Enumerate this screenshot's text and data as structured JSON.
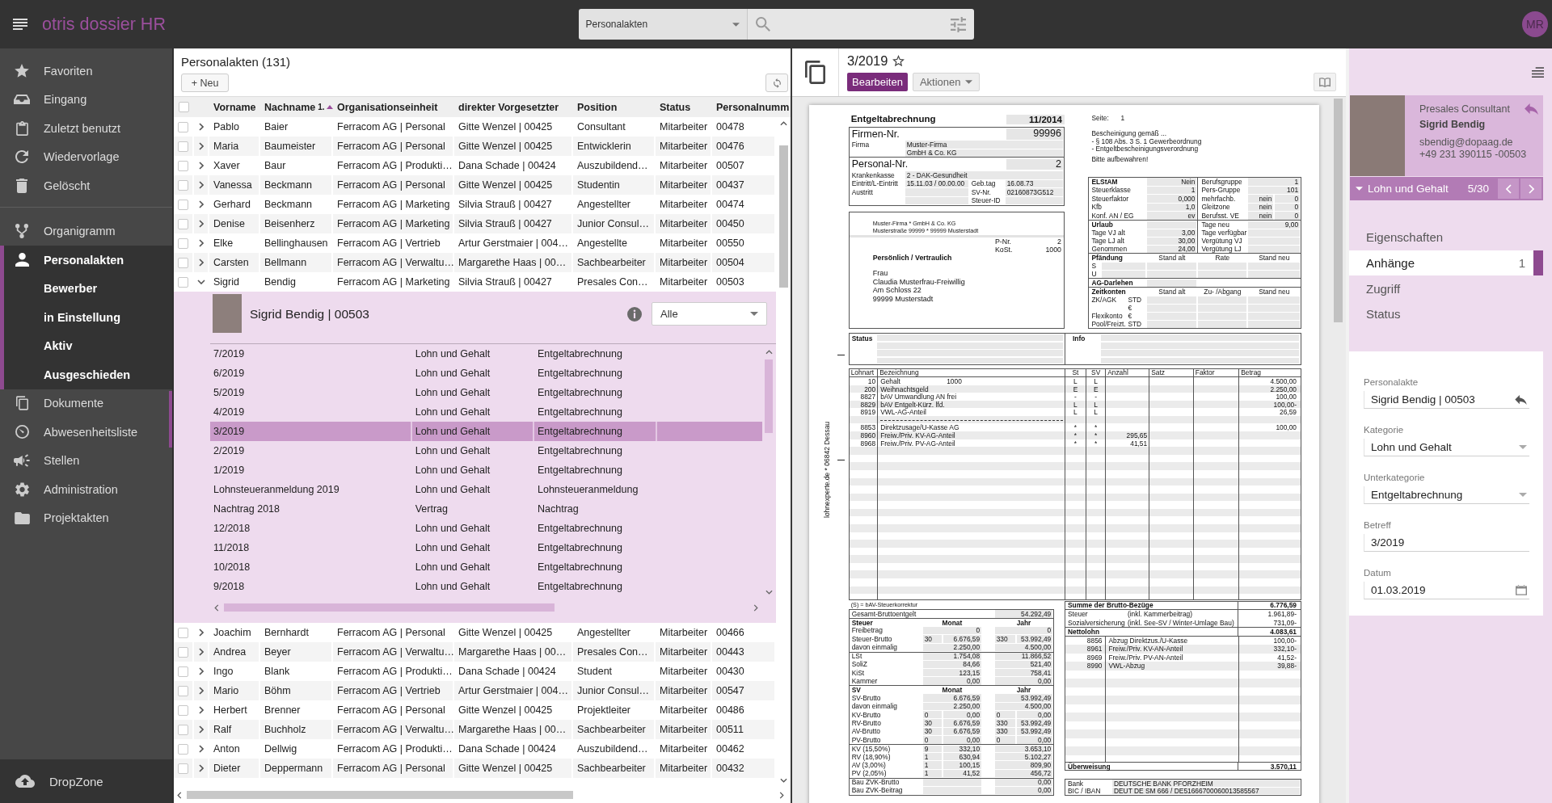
{
  "app": {
    "title": "otris dossier HR",
    "avatar": "MR"
  },
  "search": {
    "scope": "Personalakten"
  },
  "sidebar": {
    "groups": [
      {
        "items": [
          {
            "label": "Favoriten",
            "selected": false
          },
          {
            "label": "Eingang",
            "selected": false
          },
          {
            "label": "Zuletzt benutzt",
            "selected": false
          },
          {
            "label": "Wiedervorlage",
            "selected": false
          },
          {
            "label": "Gelöscht",
            "selected": false
          }
        ]
      },
      {
        "items": [
          {
            "label": "Organigramm",
            "selected": false
          },
          {
            "label": "Personalakten",
            "selected": true,
            "expanded": true,
            "children": [
              {
                "label": "Bewerber",
                "selected": false
              },
              {
                "label": "in Einstellung",
                "selected": false
              },
              {
                "label": "Aktiv",
                "selected": false
              },
              {
                "label": "Ausgeschieden",
                "selected": false
              }
            ]
          },
          {
            "label": "Dokumente",
            "selected": false
          },
          {
            "label": "Abwesenheitsliste",
            "selected": false
          },
          {
            "label": "Stellen",
            "selected": false
          },
          {
            "label": "Administration",
            "selected": false
          },
          {
            "label": "Projektakten",
            "selected": false
          }
        ]
      }
    ],
    "footer": "DropZone"
  },
  "list": {
    "title": "Personalakten (131)",
    "new_button": "+ Neu",
    "all_checked": false,
    "columns": [
      {
        "label": "Vorname"
      },
      {
        "label": "Nachname",
        "sort_ascending": true,
        "sort_rank": "1."
      },
      {
        "label": "Organisationseinheit"
      },
      {
        "label": "direkter Vorgesetzter"
      },
      {
        "label": "Position"
      },
      {
        "label": "Status"
      },
      {
        "label": "Personalnumm"
      }
    ],
    "rows": [
      {
        "cells": [
          "Pablo",
          "Baier",
          "Ferracom AG | Personal",
          "Gitte Wenzel | 00425",
          "Consultant",
          "Mitarbeiter",
          "00478"
        ],
        "checked": false,
        "expanded": false
      },
      {
        "cells": [
          "Maria",
          "Baumeister",
          "Ferracom AG | Personal",
          "Gitte Wenzel | 00425",
          "Entwicklerin",
          "Mitarbeiter",
          "00476"
        ],
        "checked": false,
        "expanded": false
      },
      {
        "cells": [
          "Xaver",
          "Baur",
          "Ferracom AG | Produkti…",
          "Dana Schade | 00424",
          "Auszubildend…",
          "Mitarbeiter",
          "00507"
        ],
        "checked": false,
        "expanded": false
      },
      {
        "cells": [
          "Vanessa",
          "Beckmann",
          "Ferracom AG | Personal",
          "Gitte Wenzel | 00425",
          "Studentin",
          "Mitarbeiter",
          "00437"
        ],
        "checked": false,
        "expanded": false
      },
      {
        "cells": [
          "Gerhard",
          "Beckmann",
          "Ferracom AG | Marketing",
          "Silvia Strauß | 00427",
          "Angestellter",
          "Mitarbeiter",
          "00474"
        ],
        "checked": false,
        "expanded": false
      },
      {
        "cells": [
          "Denise",
          "Beisenherz",
          "Ferracom AG | Marketing",
          "Silvia Strauß | 00427",
          "Junior Consul…",
          "Mitarbeiter",
          "00450"
        ],
        "checked": false,
        "expanded": false
      },
      {
        "cells": [
          "Elke",
          "Bellinghausen",
          "Ferracom AG | Vertrieb",
          "Artur Gerstmaier | 004…",
          "Angestellte",
          "Mitarbeiter",
          "00550"
        ],
        "checked": false,
        "expanded": false
      },
      {
        "cells": [
          "Carsten",
          "Bellmann",
          "Ferracom AG | Verwaltu…",
          "Margarethe Haas | 00…",
          "Sachbearbeiter",
          "Mitarbeiter",
          "00504"
        ],
        "checked": false,
        "expanded": false
      },
      {
        "cells": [
          "Sigrid",
          "Bendig",
          "Ferracom AG | Marketing",
          "Silvia Strauß | 00427",
          "Presales Con…",
          "Mitarbeiter",
          "00503"
        ],
        "checked": false,
        "expanded": true,
        "detail": {
          "title": "Sigrid Bendig | 00503",
          "filter": "Alle",
          "rows": [
            {
              "cells": [
                "7/2019",
                "Lohn und Gehalt",
                "Entgeltabrechnung"
              ],
              "selected": false
            },
            {
              "cells": [
                "6/2019",
                "Lohn und Gehalt",
                "Entgeltabrechnung"
              ],
              "selected": false
            },
            {
              "cells": [
                "5/2019",
                "Lohn und Gehalt",
                "Entgeltabrechnung"
              ],
              "selected": false
            },
            {
              "cells": [
                "4/2019",
                "Lohn und Gehalt",
                "Entgeltabrechnung"
              ],
              "selected": false
            },
            {
              "cells": [
                "3/2019",
                "Lohn und Gehalt",
                "Entgeltabrechnung"
              ],
              "selected": true
            },
            {
              "cells": [
                "2/2019",
                "Lohn und Gehalt",
                "Entgeltabrechnung"
              ],
              "selected": false
            },
            {
              "cells": [
                "1/2019",
                "Lohn und Gehalt",
                "Entgeltabrechnung"
              ],
              "selected": false
            },
            {
              "cells": [
                "Lohnsteueranmeldung 2019",
                "Lohn und Gehalt",
                "Lohnsteueranmeldung"
              ],
              "selected": false
            },
            {
              "cells": [
                "Nachtrag 2018",
                "Vertrag",
                "Nachtrag"
              ],
              "selected": false
            },
            {
              "cells": [
                "12/2018",
                "Lohn und Gehalt",
                "Entgeltabrechnung"
              ],
              "selected": false
            },
            {
              "cells": [
                "11/2018",
                "Lohn und Gehalt",
                "Entgeltabrechnung"
              ],
              "selected": false
            },
            {
              "cells": [
                "10/2018",
                "Lohn und Gehalt",
                "Entgeltabrechnung"
              ],
              "selected": false
            },
            {
              "cells": [
                "9/2018",
                "Lohn und Gehalt",
                "Entgeltabrechnung"
              ],
              "selected": false
            }
          ]
        }
      },
      {
        "cells": [
          "Joachim",
          "Bernhardt",
          "Ferracom AG | Personal",
          "Gitte Wenzel | 00425",
          "Angestellter",
          "Mitarbeiter",
          "00466"
        ],
        "checked": false,
        "expanded": false
      },
      {
        "cells": [
          "Andrea",
          "Beyer",
          "Ferracom AG | Verwaltu…",
          "Margarethe Haas | 00…",
          "Presales Con…",
          "Mitarbeiter",
          "00443"
        ],
        "checked": false,
        "expanded": false
      },
      {
        "cells": [
          "Ingo",
          "Blank",
          "Ferracom AG | Produkti…",
          "Dana Schade | 00424",
          "Student",
          "Mitarbeiter",
          "00430"
        ],
        "checked": false,
        "expanded": false
      },
      {
        "cells": [
          "Mario",
          "Böhm",
          "Ferracom AG | Vertrieb",
          "Artur Gerstmaier | 004…",
          "Junior Consul…",
          "Mitarbeiter",
          "00547"
        ],
        "checked": false,
        "expanded": false
      },
      {
        "cells": [
          "Herbert",
          "Brenner",
          "Ferracom AG | Personal",
          "Gitte Wenzel | 00425",
          "Projektleiter",
          "Mitarbeiter",
          "00486"
        ],
        "checked": false,
        "expanded": false
      },
      {
        "cells": [
          "Ralf",
          "Buchholz",
          "Ferracom AG | Verwaltu…",
          "Margarethe Haas | 00…",
          "Sachbearbeiter",
          "Mitarbeiter",
          "00511"
        ],
        "checked": false,
        "expanded": false
      },
      {
        "cells": [
          "Anton",
          "Dellwig",
          "Ferracom AG | Produkti…",
          "Dana Schade | 00424",
          "Auszubildend…",
          "Mitarbeiter",
          "00462"
        ],
        "checked": false,
        "expanded": false
      },
      {
        "cells": [
          "Dieter",
          "Deppermann",
          "Ferracom AG | Personal",
          "Gitte Wenzel | 00425",
          "Sachbearbeiter",
          "Mitarbeiter",
          "00432"
        ],
        "checked": false,
        "expanded": false
      }
    ]
  },
  "document": {
    "title": "3/2019",
    "favorite": false,
    "edit_button": "Bearbeiten",
    "actions_button": "Aktionen",
    "payslip": {
      "title": "Entgeltabrechnung",
      "period": "11/2014",
      "company": {
        "label": "Firmen-Nr.",
        "number": "99996",
        "name_label": "Firma",
        "name": [
          "Muster-Firma",
          "GmbH & Co. KG"
        ]
      },
      "employee": {
        "label": "Personal-Nr.",
        "number": "2",
        "rows": [
          {
            "label": "Krankenkasse",
            "value": "2 - DAK-Gesundheit"
          },
          {
            "label": "Eintritt/L-Eintritt",
            "value": "15.11.03 / 00.00.00",
            "label2": "Geb.tag",
            "value2": "16.08.73"
          },
          {
            "label": "Austritt",
            "label2": "SV-Nr.",
            "value2": "02160873G512"
          },
          {
            "label2": "Steuer-ID"
          }
        ]
      },
      "address": {
        "sender": [
          "Muster-Firma * GmbH & Co. KG",
          "Musterstraße 99999 * 99999 Musterstadt"
        ],
        "refs": [
          {
            "label": "P-Nr.",
            "value": "2"
          },
          {
            "label": "KoSt.",
            "value": "1000"
          }
        ],
        "mark": "Persönlich / Vertraulich",
        "recipient": [
          "Frau",
          "Claudia Musterfrau-Freiwillig",
          "Am Schloss 22",
          "99999 Musterstadt"
        ]
      },
      "page": {
        "label": "Seite:",
        "value": "1"
      },
      "notice": [
        "Bescheinigung gemäß ...",
        "- § 108 Abs. 3 S. 1 Gewerbeordnung",
        "- Entgeltbescheinigungsverordnung"
      ],
      "keep": "Bitte aufbewahren!",
      "elstam": [
        {
          "label": "ELStAM",
          "value": "Nein",
          "label2": "Berufsgruppe",
          "value2": "1"
        },
        {
          "label": "Steuerklasse",
          "value": "1",
          "label2": "Pers-Gruppe",
          "value2": "101"
        },
        {
          "label": "Steuerfaktor",
          "value": "0,000",
          "label2": "mehrfachb.",
          "flag": "nein",
          "value2": "0"
        },
        {
          "label": "Kfb",
          "value": "1,0",
          "label2": "Gleitzone",
          "flag": "nein",
          "value2": "0"
        },
        {
          "label": "Konf. AN / EG",
          "value": "ev",
          "label2": "Berufsst. VE",
          "flag": "nein",
          "value2": "0"
        }
      ],
      "vacation": [
        {
          "label": "Urlaub",
          "label2": "Tage neu",
          "value2": "9,00"
        },
        {
          "label": "Tage VJ alt",
          "value": "3,00",
          "label2": "Tage verfügbar"
        },
        {
          "label": "Tage LJ alt",
          "value": "30,00",
          "label2": "Vergütung VJ"
        },
        {
          "label": "Genommen",
          "value": "24,00",
          "label2": "Vergütung LJ"
        }
      ],
      "garnishment": {
        "columns": [
          "Pfändung",
          "Stand alt",
          "Rate",
          "Stand neu"
        ],
        "rows": [
          "S",
          "U"
        ]
      },
      "loan": "AG-Darlehen",
      "time_accounts": {
        "columns": [
          "Zeitkonten",
          "Stand alt",
          "Zu- /Abgang",
          "Stand neu"
        ],
        "rows": [
          {
            "label": "ZK/AGK",
            "unit": "STD"
          },
          {
            "unit": "€"
          },
          {
            "label": "Flexikonto",
            "unit": "€"
          },
          {
            "label": "Pool/Freizt.",
            "unit": "STD"
          }
        ]
      },
      "remarks": [
        "Status",
        "Info"
      ],
      "side_note": "lohnexperte.de * 06842 Dessau",
      "items": {
        "columns": [
          "Lohnart",
          "Bezeichnung",
          "St",
          "SV",
          "Anzahl",
          "Satz",
          "Faktor",
          "Betrag"
        ],
        "rows": [
          {
            "kind": "entry",
            "code": "10",
            "name": "Gehalt",
            "extra": "1000",
            "st": "L",
            "sv": "L",
            "amount": "4.500,00"
          },
          {
            "kind": "entry",
            "code": "200",
            "name": "Weihnachtsgeld",
            "st": "E",
            "sv": "E",
            "amount": "2.250,00"
          },
          {
            "kind": "entry",
            "code": "8827",
            "name": "bAV Umwandlung AN frei",
            "st": "-",
            "sv": "-",
            "amount": "100,00"
          },
          {
            "kind": "entry",
            "code": "8829",
            "name": "bAV Entgelt-Kürz. lfd.",
            "st": "L",
            "sv": "L",
            "amount": "100,00-"
          },
          {
            "kind": "entry",
            "code": "8919",
            "name": "VWL-AG-Anteil",
            "st": "L",
            "sv": "L",
            "amount": "26,59"
          },
          {
            "kind": "rule"
          },
          {
            "kind": "entry",
            "code": "8853",
            "name": "Direktzusage/U-Kasse AG",
            "st": "*",
            "sv": "*",
            "amount": "100,00"
          },
          {
            "kind": "entry",
            "code": "8960",
            "name": "Freiw./Priv. KV-AG-Anteil",
            "st": "*",
            "sv": "*",
            "count": "295,65"
          },
          {
            "kind": "entry",
            "code": "8968",
            "name": "Freiw./Priv. PV-AG-Anteil",
            "st": "*",
            "sv": "*",
            "count": "41,51"
          }
        ]
      },
      "footnote": "(S) = bAV-Steuerkorrektur",
      "gross_total": {
        "label": "Gesamt-Bruttoentgelt",
        "value": "54.292,49"
      },
      "tax": {
        "columns": [
          "Steuer",
          "Monat",
          "Jahr"
        ],
        "groups": [
          [
            {
              "label": "Freibetrag",
              "month": "0",
              "year": "0"
            },
            {
              "label": "Steuer-Brutto",
              "month_days": "30",
              "month": "6.676,59",
              "year_days": "330",
              "year": "53.992,49"
            },
            {
              "label": "davon einmalig",
              "month": "2.250,00",
              "year": "4.500,00"
            }
          ],
          [
            {
              "label": "LSt",
              "month": "1.754,08",
              "year": "11.866,52"
            },
            {
              "label": "SoliZ",
              "month": "84,66",
              "year": "521,40"
            },
            {
              "label": "KiSt",
              "month": "123,15",
              "year": "758,41"
            },
            {
              "label": "Kammer",
              "month": "0,00",
              "year": "0,00"
            }
          ]
        ]
      },
      "social": {
        "columns": [
          "SV",
          "Monat",
          "Jahr"
        ],
        "groups": [
          [
            {
              "label": "SV-Brutto",
              "month": "6.676,59",
              "year": "53.992,49"
            },
            {
              "label": "davon einmalig",
              "month": "2.250,00",
              "year": "4.500,00"
            },
            {
              "label": "KV-Brutto",
              "month_days": "0",
              "month": "0,00",
              "year_days": "0",
              "year": "0,00"
            },
            {
              "label": "RV-Brutto",
              "month_days": "30",
              "month": "6.676,59",
              "year_days": "330",
              "year": "53.992,49"
            },
            {
              "label": "AV-Brutto",
              "month_days": "30",
              "month": "6.676,59",
              "year_days": "330",
              "year": "53.992,49"
            },
            {
              "label": "PV-Brutto",
              "month_days": "0",
              "month": "0,00",
              "year_days": "0",
              "year": "0,00"
            }
          ],
          [
            {
              "label": "KV (15,50%)",
              "month_days": "9",
              "month": "332,10",
              "year": "3.653,10"
            },
            {
              "label": "RV (18,90%)",
              "month_days": "1",
              "month": "630,94",
              "year": "5.102,27"
            },
            {
              "label": "AV (3,00%)",
              "month_days": "1",
              "month": "100,15",
              "year": "809,90"
            },
            {
              "label": "PV (2,05%)",
              "month_days": "1",
              "month": "41,52",
              "year": "456,72"
            }
          ],
          [
            {
              "label": "Bau ZVK-Brutto",
              "year": "0,00"
            },
            {
              "label": "Bau ZVK-Beitrag",
              "year": "0,00"
            }
          ]
        ]
      },
      "net": {
        "gross": {
          "label": "Summe der Brutto-Bezüge",
          "value": "6.776,59"
        },
        "deductions": [
          {
            "label": "Steuer",
            "note": "(inkl. Kammerbeitrag)",
            "value": "1.961,89-"
          },
          {
            "label": "Sozialversicherung",
            "note": "(inkl. See-SV / Winter-Umlage Bau)",
            "value": "731,09-"
          }
        ],
        "net": {
          "label": "Nettolohn",
          "value": "4.083,61"
        },
        "items": [
          {
            "code": "8856",
            "name": "Abzug Direktzus./U-Kasse",
            "value": "100,00-"
          },
          {
            "code": "8961",
            "name": "Freiw./Priv. KV-AN-Anteil",
            "value": "332,10-"
          },
          {
            "code": "8969",
            "name": "Freiw./Priv. PV-AN-Anteil",
            "value": "41,52-"
          },
          {
            "code": "8990",
            "name": "VWL-Abzug",
            "value": "39,88-"
          }
        ],
        "payout": {
          "label": "Überweisung",
          "value": "3.570,11"
        }
      },
      "bank": [
        {
          "label": "Bank",
          "value": "DEUTSCHE BANK PFORZHEIM"
        },
        {
          "label": "BIC / IBAN",
          "value": "DEUT DE SM 666 / DE51666700060013585567"
        }
      ]
    }
  },
  "record": {
    "profile": {
      "role": "Presales Consultant",
      "name": "Sigrid Bendig",
      "email": "sbendig@dopaag.de",
      "phone": "+49 231 390115 -00503"
    },
    "category": {
      "label": "Lohn und Gehalt",
      "position": "5/30"
    },
    "tabs": [
      {
        "label": "Eigenschaften",
        "selected": false
      },
      {
        "label": "Anhänge",
        "count": "1",
        "selected": true
      },
      {
        "label": "Zugriff",
        "selected": false
      },
      {
        "label": "Status",
        "selected": false
      }
    ],
    "form": [
      {
        "label": "Personalakte",
        "value": "Sigrid Bendig | 00503",
        "kind": "link"
      },
      {
        "label": "Kategorie",
        "value": "Lohn und Gehalt",
        "kind": "select"
      },
      {
        "label": "Unterkategorie",
        "value": "Entgeltabrechnung",
        "kind": "select"
      },
      {
        "label": "Betreff",
        "value": "3/2019",
        "kind": "text"
      },
      {
        "label": "Datum",
        "value": "01.03.2019",
        "kind": "date"
      }
    ]
  }
}
